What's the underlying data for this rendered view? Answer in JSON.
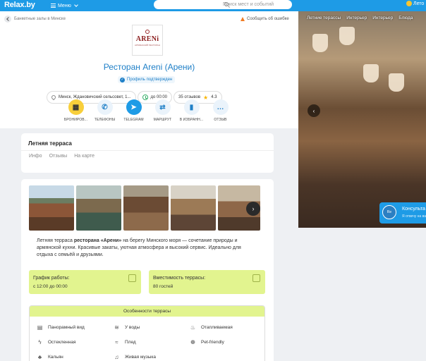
{
  "topbar": {
    "logo": "Relax.by",
    "menu_label": "Меню",
    "search_placeholder": "Поиск мест и событий",
    "weather_label": "Лето"
  },
  "header": {
    "breadcrumb": "Банкетные залы в Минске",
    "report_label": "Сообщить об ошибке",
    "logo_name": "ARENi",
    "logo_sub": "АРМЯНСКИЙ РЕСТОРАН",
    "title": "Ресторан Areni (Арени)",
    "verified_label": "Профиль подтвержден",
    "address": "Минск, Ждановичский сельсовет, 1...",
    "hours": "до 00:00",
    "reviews": "35 отзывов",
    "rating": "4.3"
  },
  "actions": [
    {
      "label": "БРОНИРОВ...",
      "icon": "calendar-icon",
      "glyph": "▦"
    },
    {
      "label": "ТЕЛЕФОНЫ",
      "icon": "phone-icon",
      "glyph": "✆"
    },
    {
      "label": "TELEGRAM",
      "icon": "telegram-icon",
      "glyph": "➤"
    },
    {
      "label": "МАРШРУТ",
      "icon": "route-icon",
      "glyph": "⇄"
    },
    {
      "label": "В ИЗБРАНН...",
      "icon": "bookmark-icon",
      "glyph": "▮"
    },
    {
      "label": "ОТЗЫВ",
      "icon": "comment-icon",
      "glyph": "…"
    }
  ],
  "section": {
    "title": "Летняя терраса",
    "tabs": [
      "Инфо",
      "Отзывы",
      "На карте"
    ]
  },
  "description": {
    "part1": "Летняя терраса ",
    "bold": "ресторана «Арени»",
    "part2": " на берегу Минского моря — сочетание природы и армянской кухни. Красивые закаты, уютная атмосфера и высокий сервис. Идеально для отдыха с семьёй и друзьями."
  },
  "info": {
    "schedule_title": "График работы:",
    "schedule_value": "с 12:00 до 00:00",
    "capacity_title": "Вместимость террасы:",
    "capacity_value": "80 гостей"
  },
  "features": {
    "title": "Особенности террасы",
    "items": [
      {
        "label": "Панорамный вид",
        "icon": "panorama-icon",
        "glyph": "▤"
      },
      {
        "label": "У воды",
        "icon": "water-icon",
        "glyph": "≋"
      },
      {
        "label": "Отапливаемая",
        "icon": "heater-icon",
        "glyph": "♨"
      },
      {
        "label": "Остекленная",
        "icon": "glass-icon",
        "glyph": "ϟ"
      },
      {
        "label": "Плед",
        "icon": "blanket-icon",
        "glyph": "≈"
      },
      {
        "label": "Pet-friendly",
        "icon": "paw-icon",
        "glyph": "❁"
      },
      {
        "label": "Кальян",
        "icon": "hookah-icon",
        "glyph": "♣"
      },
      {
        "label": "Живая музыка",
        "icon": "music-icon",
        "glyph": "♫"
      }
    ]
  },
  "photo": {
    "tabs": [
      "Летние терассы",
      "Интерьер",
      "Интерьер",
      "Блюда"
    ]
  },
  "consult": {
    "avatar": "Re",
    "title": "Консульта",
    "subtitle": "Я отвечу на ва"
  }
}
